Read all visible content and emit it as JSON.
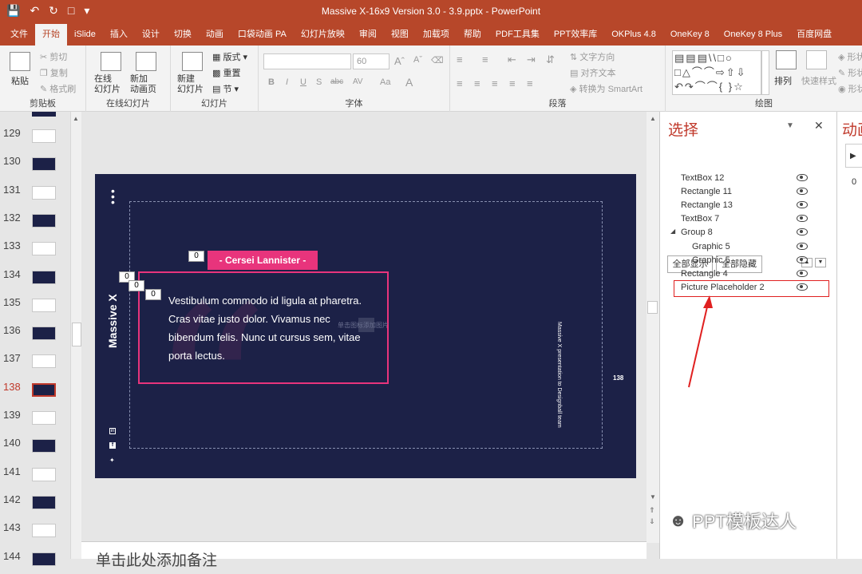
{
  "window": {
    "title": "Massive X-16x9 Version 3.0 - 3.9.pptx - PowerPoint"
  },
  "tabs": [
    "文件",
    "开始",
    "iSlide",
    "插入",
    "设计",
    "切换",
    "动画",
    "口袋动画 PA",
    "幻灯片放映",
    "审阅",
    "视图",
    "加载项",
    "帮助",
    "PDF工具集",
    "PPT效率库",
    "OKPlus 4.8",
    "OneKey 8",
    "OneKey 8 Plus",
    "百度网盘"
  ],
  "ribbon": {
    "clipboard": {
      "label": "剪贴板",
      "paste": "粘贴",
      "cut": "剪切",
      "copy": "复制",
      "format_painter": "格式刷"
    },
    "online": {
      "label": "在线幻灯片",
      "online_slides": "在线\n幻灯片",
      "new_anim_page": "新加\n动画页"
    },
    "slides": {
      "label": "幻灯片",
      "new_slide": "新建\n幻灯片",
      "layout": "版式",
      "reset": "重置",
      "section": "节"
    },
    "font": {
      "label": "字体",
      "size": "60",
      "bold": "B",
      "italic": "I",
      "underline": "U",
      "shadow": "S",
      "strike": "abc",
      "spacing": "AV",
      "case": "Aa",
      "color": "A"
    },
    "paragraph": {
      "label": "段落",
      "text_direction": "文字方向",
      "align_text": "对齐文本",
      "to_smartart": "转换为 SmartArt"
    },
    "drawing": {
      "label": "绘图",
      "arrange": "排列",
      "quick_styles": "快速样式",
      "shape_fill": "形状",
      "shape_outline": "形状",
      "shape_effects": "形状"
    }
  },
  "thumbnails": [
    {
      "num": "129",
      "bg": "#ffffff"
    },
    {
      "num": "130",
      "bg": "#1c2147"
    },
    {
      "num": "131",
      "bg": "#ffffff"
    },
    {
      "num": "132",
      "bg": "#1c2147"
    },
    {
      "num": "133",
      "bg": "#ffffff"
    },
    {
      "num": "134",
      "bg": "#1c2147"
    },
    {
      "num": "135",
      "bg": "#ffffff"
    },
    {
      "num": "136",
      "bg": "#1c2147"
    },
    {
      "num": "137",
      "bg": "#ffffff"
    },
    {
      "num": "138",
      "bg": "#1c2147",
      "current": true
    },
    {
      "num": "139",
      "bg": "#ffffff"
    },
    {
      "num": "140",
      "bg": "#1c2147"
    },
    {
      "num": "141",
      "bg": "#ffffff"
    },
    {
      "num": "142",
      "bg": "#1c2147"
    },
    {
      "num": "143",
      "bg": "#ffffff"
    },
    {
      "num": "144",
      "bg": "#1c2147"
    }
  ],
  "slide": {
    "brand": "Massive X",
    "name_tag": "- Cersei Lannister -",
    "quote": "Vestibulum commodo id ligula at pharetra. Cras vitae justo dolor. Vivamus nec bibendum felis. Nunc ut cursus sem, vitae porta lectus.",
    "placeholder_hint": "单击图标添加图片",
    "side_text": "Massive X presentation to Designball team",
    "page_num": "138",
    "anim_badges": [
      "0",
      "0",
      "0",
      "0"
    ],
    "social": [
      "linkedin-icon",
      "facebook-icon",
      "twitter-icon"
    ],
    "bg": "#1c2147",
    "accent": "#e8347c"
  },
  "notes_placeholder": "单击此处添加备注",
  "selection_pane": {
    "title": "选择",
    "show_all": "全部显示",
    "hide_all": "全部隐藏",
    "items": [
      {
        "label": "TextBox 12",
        "level": 0
      },
      {
        "label": "Rectangle 11",
        "level": 0
      },
      {
        "label": "Rectangle 13",
        "level": 0
      },
      {
        "label": "TextBox 7",
        "level": 0
      },
      {
        "label": "Group 8",
        "level": 0,
        "group": true
      },
      {
        "label": "Graphic 5",
        "level": 1
      },
      {
        "label": "Graphic 5",
        "level": 1
      },
      {
        "label": "Rectangle 4",
        "level": 0
      },
      {
        "label": "Picture Placeholder 2",
        "level": 0,
        "highlighted": true
      }
    ],
    "highlight_color": "#e02020"
  },
  "anim_pane": {
    "title": "动画",
    "value": "0"
  },
  "watermark": "PPT模板达人"
}
